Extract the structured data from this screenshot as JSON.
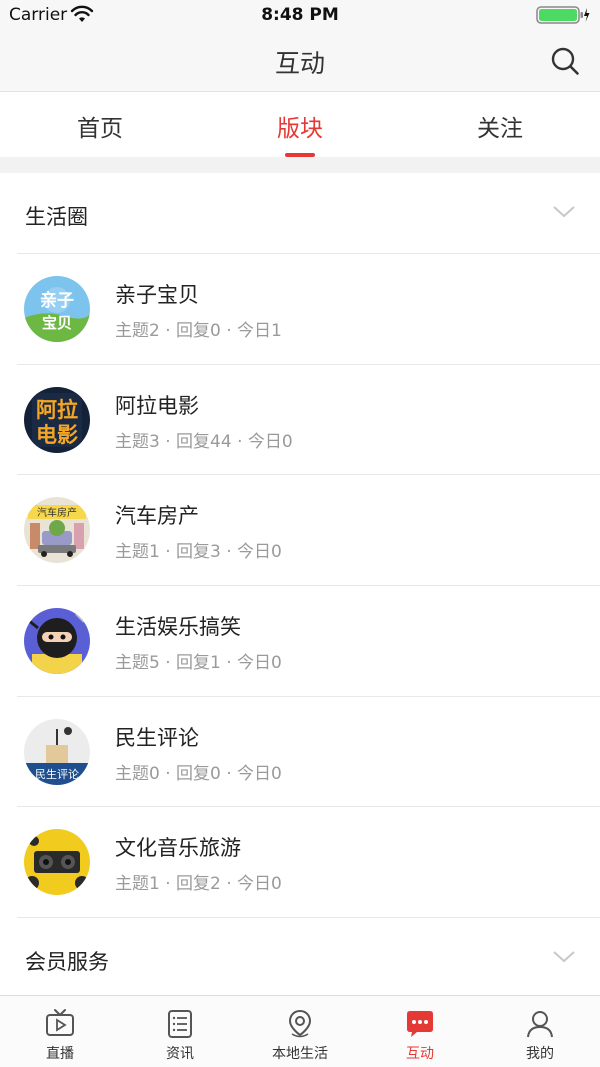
{
  "status_bar": {
    "carrier": "Carrier",
    "time": "8:48 PM"
  },
  "header": {
    "title": "互动"
  },
  "tabs": [
    {
      "label": "首页",
      "active": false
    },
    {
      "label": "版块",
      "active": true
    },
    {
      "label": "关注",
      "active": false
    }
  ],
  "sections": [
    {
      "title": "生活圈",
      "boards": [
        {
          "name": "亲子宝贝",
          "stats": "主题2 · 回复0 · 今日1"
        },
        {
          "name": "阿拉电影",
          "stats": "主题3 · 回复44 · 今日0"
        },
        {
          "name": "汽车房产",
          "stats": "主题1 · 回复3 · 今日0"
        },
        {
          "name": "生活娱乐搞笑",
          "stats": "主题5 · 回复1 · 今日0"
        },
        {
          "name": "民生评论",
          "stats": "主题0 · 回复0 · 今日0"
        },
        {
          "name": "文化音乐旅游",
          "stats": "主题1 · 回复2 · 今日0"
        }
      ]
    },
    {
      "title": "会员服务",
      "boards": []
    }
  ],
  "avatar_text": {
    "qinzi_top": "亲子",
    "qinzi_bottom": "宝贝",
    "dianying_top": "阿拉",
    "dianying_bottom": "电影",
    "qiche": "汽车房产",
    "minsheng": "民生评论"
  },
  "tab_bar": [
    {
      "label": "直播",
      "icon": "tv-icon",
      "active": false
    },
    {
      "label": "资讯",
      "icon": "news-icon",
      "active": false
    },
    {
      "label": "本地生活",
      "icon": "location-icon",
      "active": false
    },
    {
      "label": "互动",
      "icon": "chat-icon",
      "active": true
    },
    {
      "label": "我的",
      "icon": "profile-icon",
      "active": false
    }
  ],
  "colors": {
    "accent": "#e53935",
    "background": "#f2f2f2",
    "secondary_text": "#9a9a9a"
  }
}
